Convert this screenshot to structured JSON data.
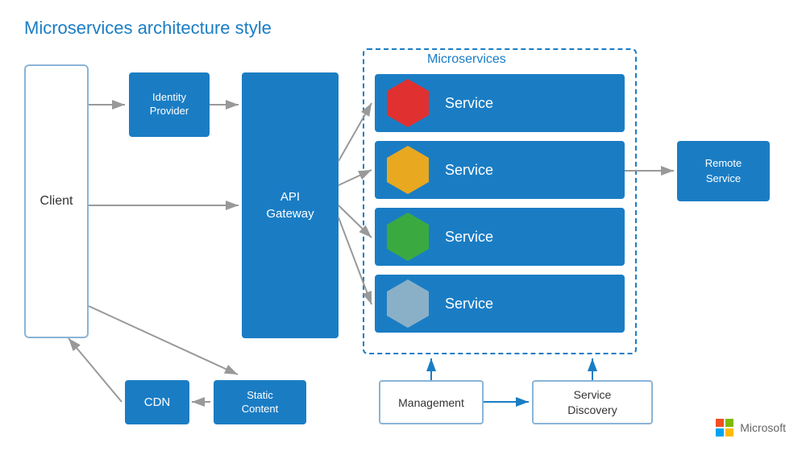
{
  "title": "Microservices architecture style",
  "microservices_section_label": "Microservices",
  "client_label": "Client",
  "identity_label": "Identity\nProvider",
  "gateway_label": "API\nGateway",
  "services": [
    {
      "label": "Service",
      "hex_color": "red"
    },
    {
      "label": "Service",
      "hex_color": "yellow"
    },
    {
      "label": "Service",
      "hex_color": "green"
    },
    {
      "label": "Service",
      "hex_color": "gray"
    }
  ],
  "remote_service_label": "Remote\nService",
  "management_label": "Management",
  "discovery_label": "Service\nDiscovery",
  "cdn_label": "CDN",
  "static_content_label": "Static\nContent",
  "microsoft_label": "Microsoft"
}
